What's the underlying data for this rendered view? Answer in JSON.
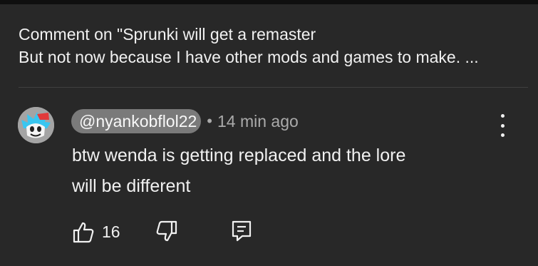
{
  "context": {
    "line1": "Comment on \"Sprunki will get a remaster",
    "line2": "But not now because I have other mods and games to make. ..."
  },
  "comment": {
    "author": "@nyankobflol22",
    "separator": "•",
    "time": "14 min ago",
    "text_line1": "btw wenda is getting replaced and the lore",
    "text_line2": "will be different",
    "avatar_icon": "avatar-character-icon"
  },
  "actions": {
    "like_count": "16",
    "like_icon": "thumb-up-icon",
    "dislike_icon": "thumb-down-icon",
    "reply_icon": "reply-icon",
    "more_icon": "more-vertical-icon"
  },
  "colors": {
    "background": "#282828",
    "text": "#f1f1f1",
    "secondary_text": "#aaaaaa",
    "chip": "#7a7a7a",
    "divider": "#3f3f3f",
    "avatar_accent": "#39c6f0",
    "avatar_secondary": "#e23a3a"
  }
}
